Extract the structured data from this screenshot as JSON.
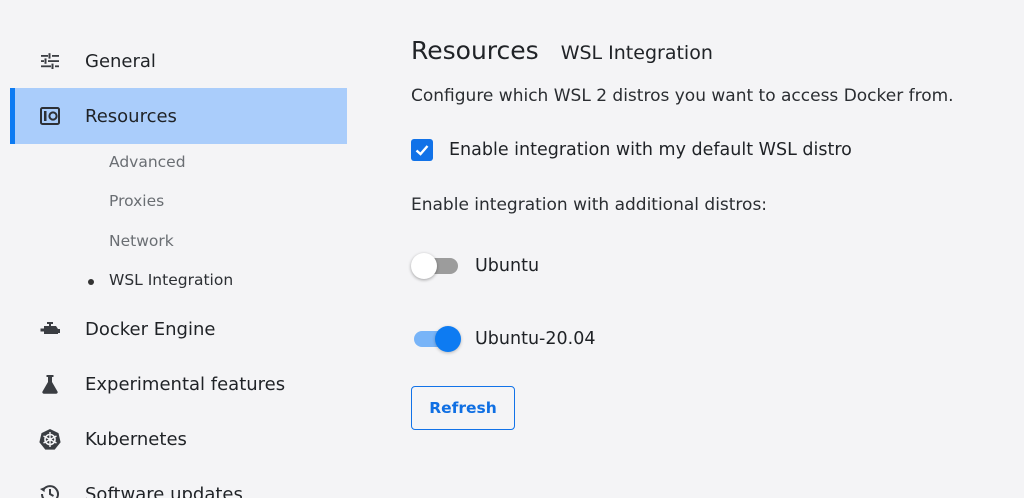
{
  "sidebar": {
    "items": [
      {
        "label": "General",
        "icon": "sliders-icon"
      },
      {
        "label": "Resources",
        "icon": "resources-icon"
      },
      {
        "label": "Docker Engine",
        "icon": "engine-icon"
      },
      {
        "label": "Experimental features",
        "icon": "flask-icon"
      },
      {
        "label": "Kubernetes",
        "icon": "kubernetes-icon"
      },
      {
        "label": "Software updates",
        "icon": "history-icon"
      }
    ],
    "sub_items": [
      "Advanced",
      "Proxies",
      "Network",
      "WSL Integration"
    ],
    "active_item": "Resources",
    "current_sub_item": "WSL Integration"
  },
  "main": {
    "title": "Resources",
    "subtitle": "WSL Integration",
    "description": "Configure which WSL 2 distros you want to access Docker from.",
    "default_checkbox": {
      "label": "Enable integration with my default WSL distro",
      "checked": true
    },
    "additional_label": "Enable integration with additional distros:",
    "distros": [
      {
        "name": "Ubuntu",
        "enabled": false
      },
      {
        "name": "Ubuntu-20.04",
        "enabled": true
      }
    ],
    "refresh_label": "Refresh"
  },
  "colors": {
    "accent": "#0d7bf2",
    "active_bg": "#aacdfb",
    "background": "#f4f4f6"
  }
}
